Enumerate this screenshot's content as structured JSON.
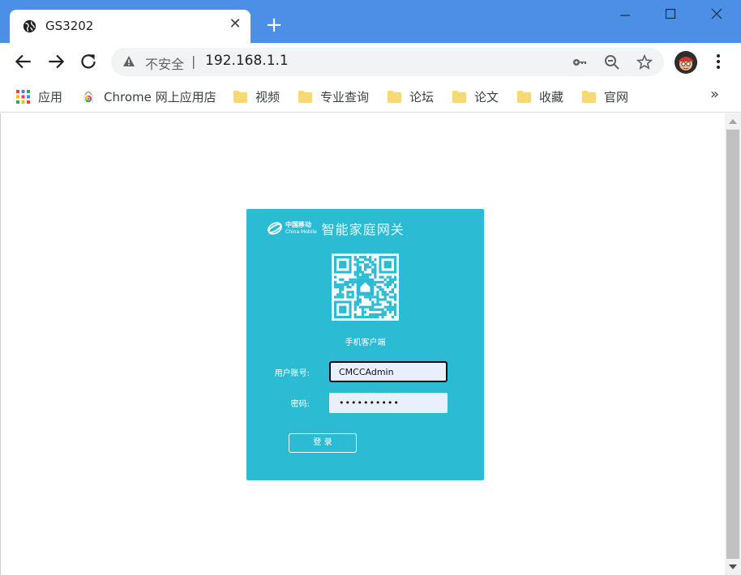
{
  "browser": {
    "tab": {
      "title": "GS3202",
      "close_icon": "close-icon",
      "favicon": "globe-icon"
    },
    "new_tab_label": "+",
    "window_controls": [
      "minimize-icon",
      "maximize-icon",
      "close-icon"
    ],
    "colors": {
      "titlebar": "#4c8fe7",
      "tab": "#ffffff"
    }
  },
  "toolbar": {
    "nav": [
      "back-arrow-icon",
      "forward-arrow-icon",
      "reload-icon"
    ],
    "omnibox": {
      "security_text": "不安全",
      "separator": "|",
      "url": "192.168.1.1",
      "icons": [
        "key-icon",
        "zoom-out-icon",
        "star-icon"
      ]
    },
    "menu_icon": "more-vert-icon"
  },
  "bookmarks": {
    "items": [
      {
        "label": "应用",
        "icon": "apps-grid-icon"
      },
      {
        "label": "Chrome 网上应用店",
        "icon": "chrome-webstore-icon"
      },
      {
        "label": "视频",
        "icon": "folder-icon"
      },
      {
        "label": "专业查询",
        "icon": "folder-icon"
      },
      {
        "label": "论坛",
        "icon": "folder-icon"
      },
      {
        "label": "论文",
        "icon": "folder-icon"
      },
      {
        "label": "收藏",
        "icon": "folder-icon"
      },
      {
        "label": "官网",
        "icon": "folder-icon"
      }
    ],
    "more_label": "»"
  },
  "login": {
    "brand_cn": "中国移动",
    "brand_en": "China Mobile",
    "product_name": "智能家庭网关",
    "qr_caption": "手机客户端",
    "username_label": "用户账号:",
    "username_value": "CMCCAdmin",
    "password_label": "密码:",
    "password_value": "••••••••••",
    "login_button": "登 录",
    "colors": {
      "panel": "#2bbcd3",
      "input_bg": "#e8f0fe"
    }
  }
}
